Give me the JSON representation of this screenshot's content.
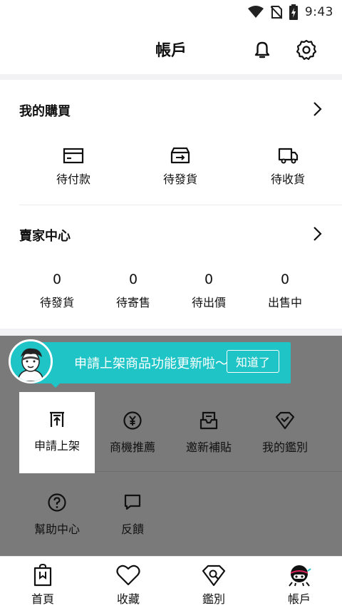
{
  "status_bar": {
    "time": "9:43",
    "icons": [
      "wifi-icon",
      "no-sim-icon",
      "battery-charging-icon"
    ]
  },
  "header": {
    "title": "帳戶",
    "icons": [
      "bell-icon",
      "gear-icon"
    ]
  },
  "my_purchases": {
    "title": "我的購買",
    "items": [
      {
        "label": "待付款",
        "icon": "card-icon"
      },
      {
        "label": "待發貨",
        "icon": "box-icon"
      },
      {
        "label": "待收貨",
        "icon": "truck-icon"
      }
    ]
  },
  "seller_center": {
    "title": "賣家中心",
    "items": [
      {
        "count": "0",
        "label": "待發貨"
      },
      {
        "count": "0",
        "label": "待寄售"
      },
      {
        "count": "0",
        "label": "待出價"
      },
      {
        "count": "0",
        "label": "出售中"
      }
    ]
  },
  "tip": {
    "text": "申請上架商品功能更新啦～",
    "button": "知道了",
    "accent": "#1fc4c7"
  },
  "tools": [
    {
      "label": "申請上架",
      "icon": "upload-shelf-icon"
    },
    {
      "label": "商機推薦",
      "icon": "yen-coin-icon"
    },
    {
      "label": "邀新補貼",
      "icon": "invite-mail-icon"
    },
    {
      "label": "我的鑑別",
      "icon": "diamond-check-icon"
    },
    {
      "label": "幫助中心",
      "icon": "help-icon"
    },
    {
      "label": "反饋",
      "icon": "chat-icon"
    }
  ],
  "tabbar": [
    {
      "label": "首頁",
      "icon": "shopping-bag-icon"
    },
    {
      "label": "收藏",
      "icon": "heart-icon"
    },
    {
      "label": "鑑別",
      "icon": "diamond-search-icon"
    },
    {
      "label": "帳戶",
      "icon": "ninja-avatar-icon"
    }
  ]
}
